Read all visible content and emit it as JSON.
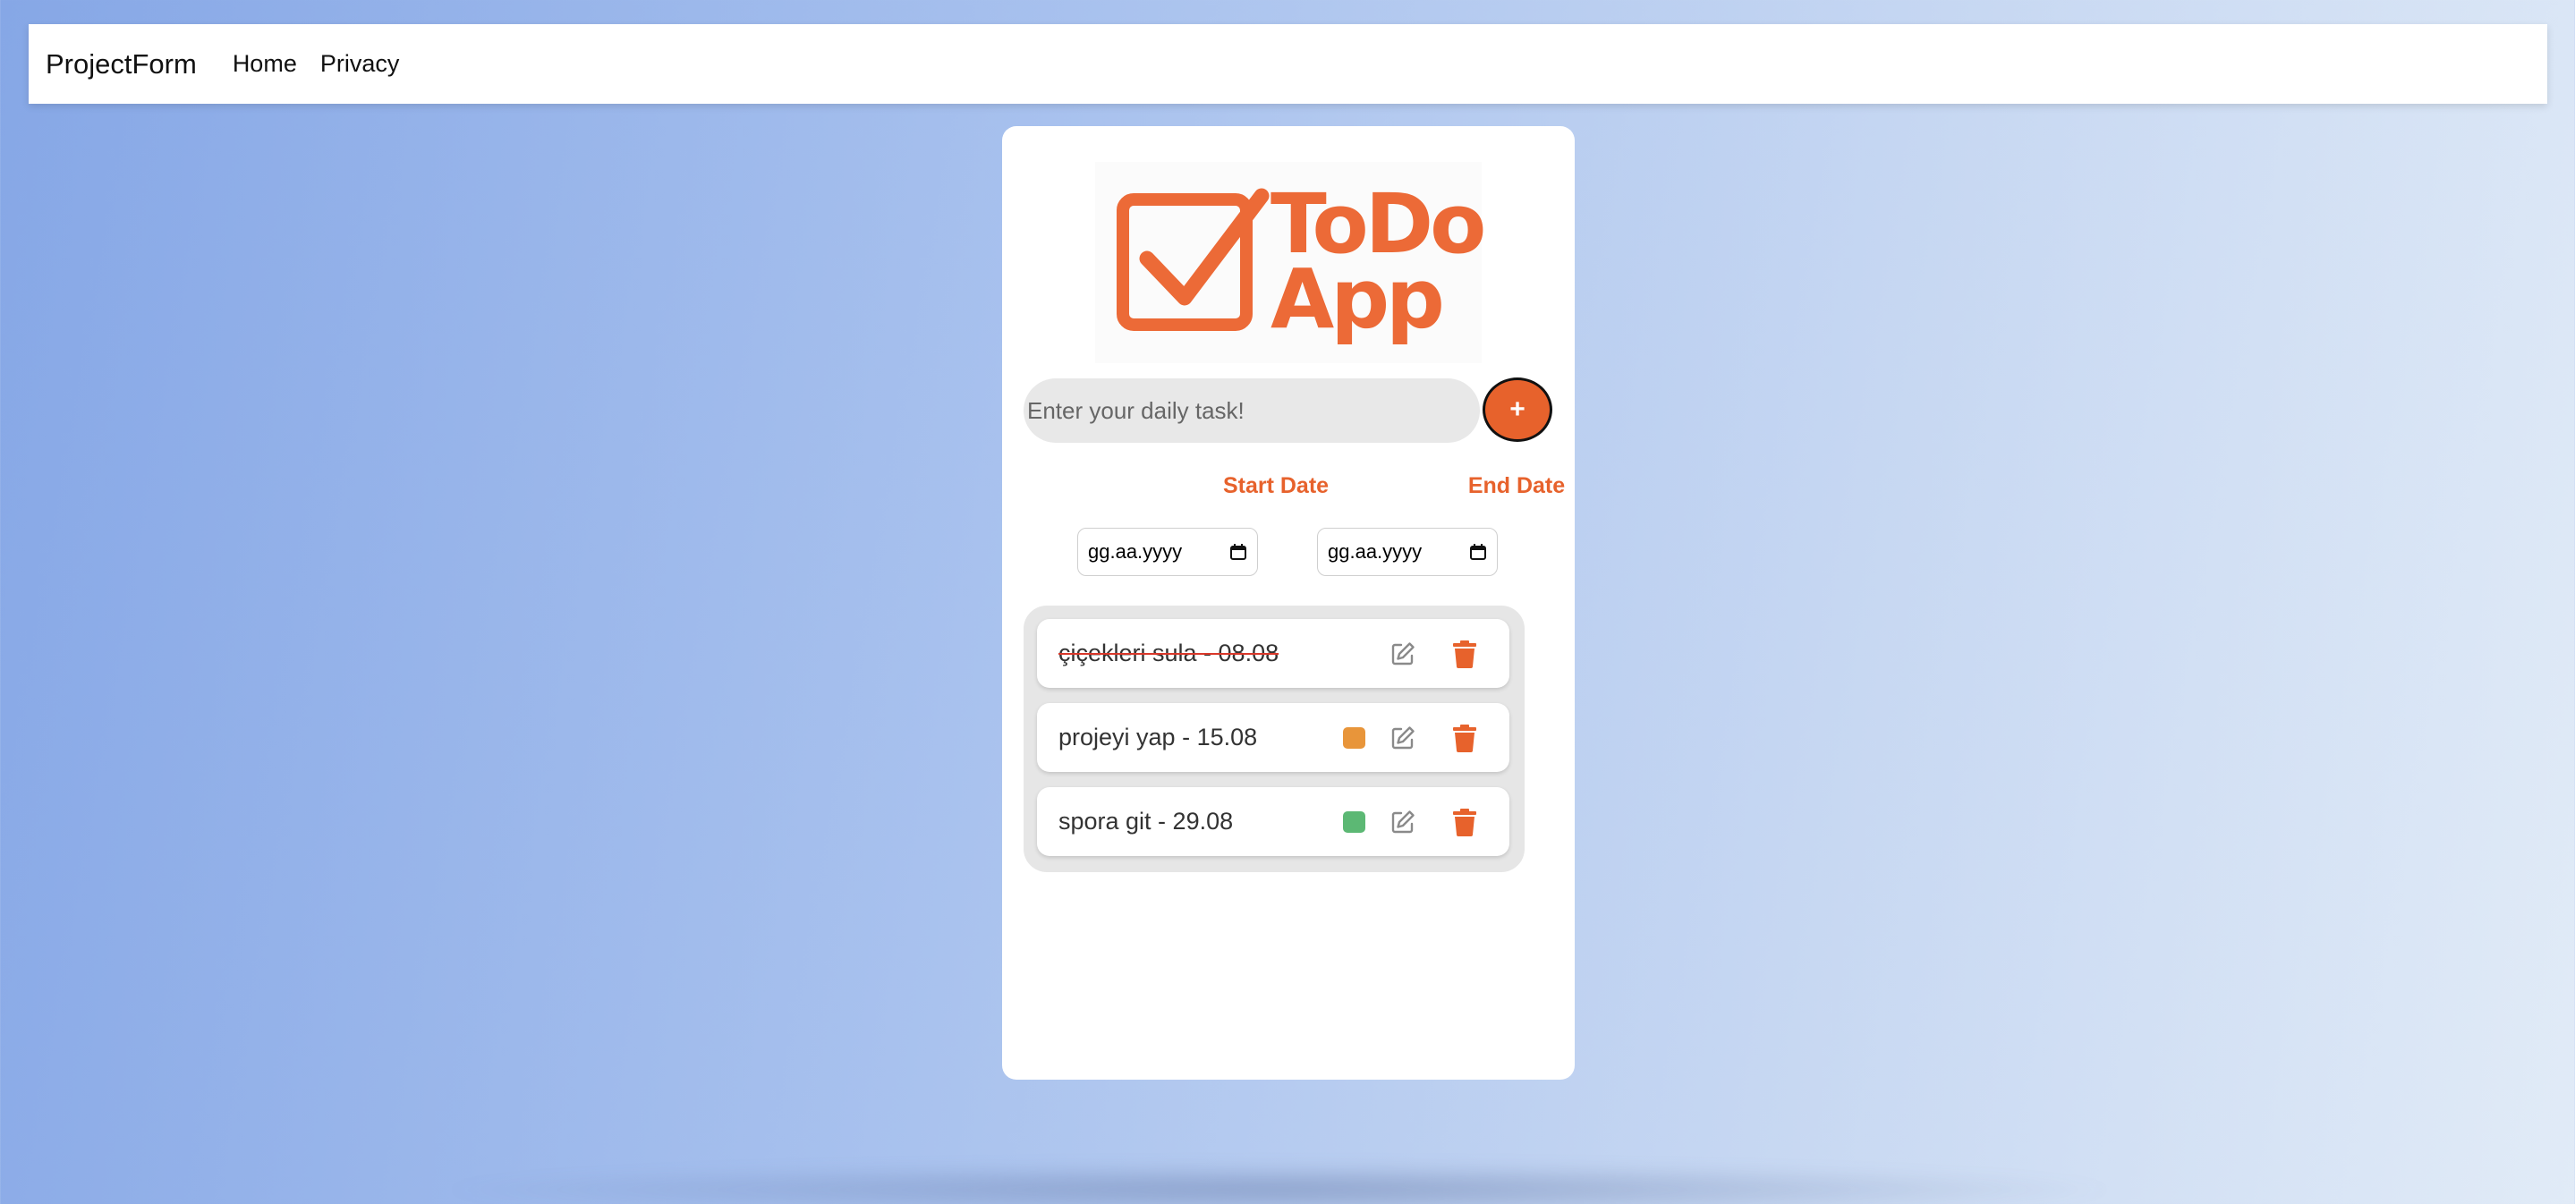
{
  "navbar": {
    "brand": "ProjectForm",
    "links": [
      {
        "label": "Home"
      },
      {
        "label": "Privacy"
      }
    ]
  },
  "logo": {
    "line1": "ToDo",
    "line2": "App",
    "icon": "checkbox-check-icon",
    "color": "#ec6a37"
  },
  "task_input": {
    "value": "",
    "placeholder": "Enter your daily task!"
  },
  "add_button": {
    "label": "+",
    "color": "#e7622c"
  },
  "dates": {
    "start_label": "Start Date",
    "end_label": "End Date",
    "start_value": "gg.aa.yyyy",
    "end_value": "gg.aa.yyyy",
    "icon": "calendar-icon"
  },
  "tasks": [
    {
      "text": "çiçekleri sula - 08.08",
      "completed": true,
      "priority_color": null
    },
    {
      "text": "projeyi yap - 15.08",
      "completed": false,
      "priority_color": "#e8953a"
    },
    {
      "text": "spora git - 29.08",
      "completed": false,
      "priority_color": "#5cb874"
    }
  ],
  "icons": {
    "edit": "edit-icon",
    "delete": "trash-icon"
  },
  "colors": {
    "accent": "#e7622c",
    "delete_icon": "#e7622c",
    "edit_icon": "#8a8a8a"
  }
}
